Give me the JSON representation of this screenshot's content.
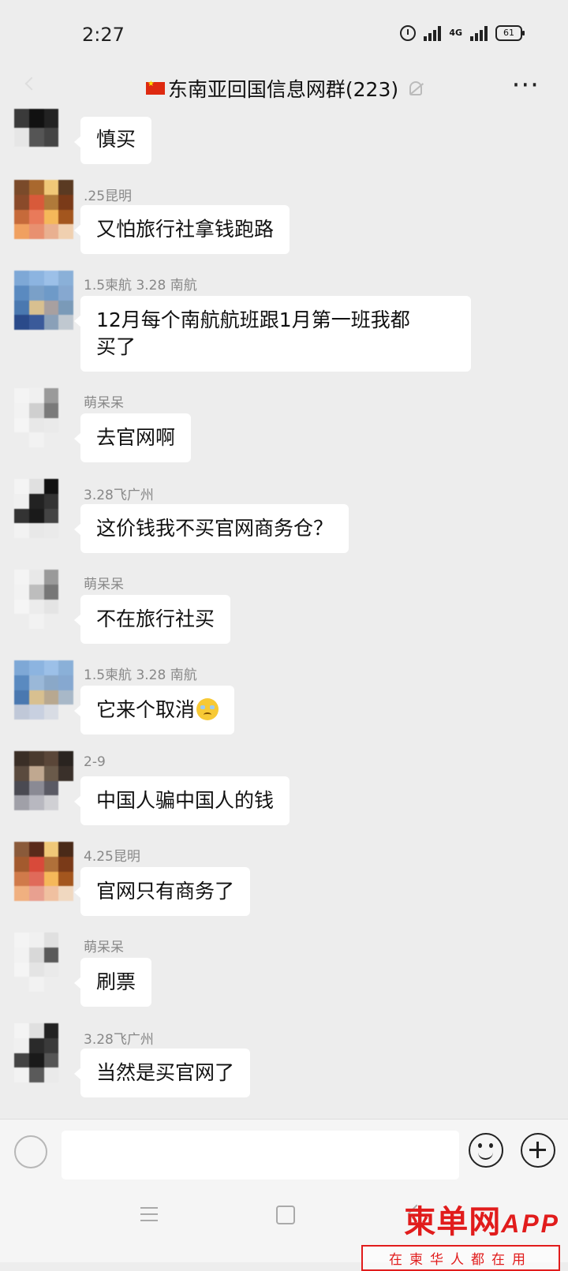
{
  "status_bar": {
    "time": "2:27",
    "network": "4G",
    "battery": "61"
  },
  "header": {
    "title": "东南亚回国信息网群(223)"
  },
  "messages": [
    {
      "sender": "",
      "text": "慎买"
    },
    {
      "sender": ".25昆明",
      "text": "又怕旅行社拿钱跑路"
    },
    {
      "sender": "1.5柬航 3.28 南航",
      "text": "12月每个南航航班跟1月第一班我都",
      "text2": "买了"
    },
    {
      "sender": "萌呆呆",
      "text": "去官网啊"
    },
    {
      "sender": "3.28飞广州",
      "text": "这价钱我不买官网商务仓？"
    },
    {
      "sender": "萌呆呆",
      "text": "不在旅行社买"
    },
    {
      "sender": "1.5柬航 3.28 南航",
      "text": "它来个取消"
    },
    {
      "sender": "2-9",
      "text": "中国人骗中国人的钱"
    },
    {
      "sender": "4.25昆明",
      "text": "官网只有商务了"
    },
    {
      "sender": "萌呆呆",
      "text": "刷票"
    },
    {
      "sender": "3.28飞广州",
      "text": "当然是买官网了"
    }
  ],
  "watermark": {
    "brand": "柬单网",
    "app": "APP",
    "tagline": "在柬华人都在用"
  },
  "colors": {
    "background": "#ededed",
    "bubble": "#ffffff",
    "watermark": "#e11c1c"
  }
}
